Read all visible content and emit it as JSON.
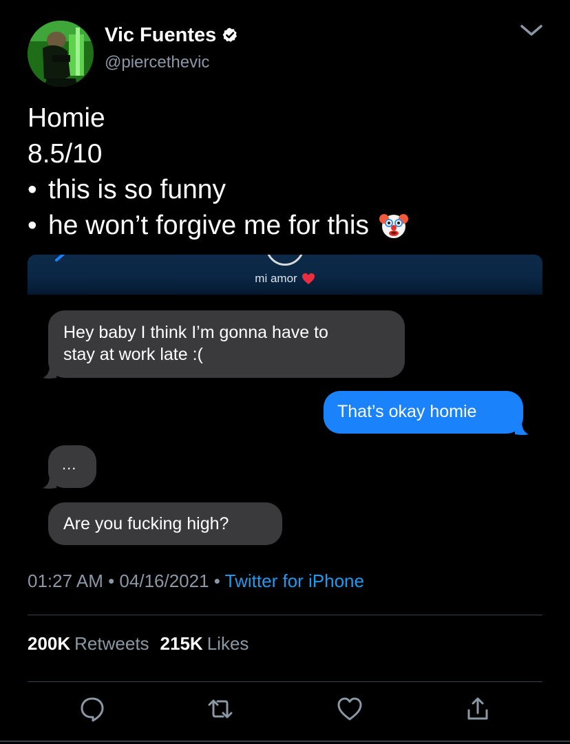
{
  "author": {
    "display_name": "Vic Fuentes",
    "handle": "@piercethevic",
    "verified": true,
    "avatar_icon": "profile-photo"
  },
  "tweet": {
    "lines": [
      "Homie",
      "8.5/10",
      "• this is so funny",
      "• he won’t forgive me for this"
    ],
    "line3_text": "this is so funny",
    "line4_text": "he won’t forgive me for this",
    "bullet": "•",
    "trailing_emoji": "clown-face-emoji"
  },
  "media": {
    "contact_name": "mi amor",
    "contact_emoji": "red-heart-emoji",
    "messages": [
      {
        "direction": "incoming",
        "text_line1": "Hey baby I think I’m gonna have to",
        "text_line2": "stay at work late :("
      },
      {
        "direction": "outgoing",
        "text": "That’s okay homie"
      },
      {
        "direction": "incoming",
        "text": "..."
      },
      {
        "direction": "incoming",
        "text": "Are you fucking high?"
      }
    ]
  },
  "meta": {
    "time": "01:27 AM",
    "separator": " • ",
    "date": "04/16/2021",
    "source": "Twitter for iPhone"
  },
  "stats": {
    "retweets_count": "200K",
    "retweets_label": "Retweets",
    "likes_count": "215K",
    "likes_label": "Likes"
  },
  "actions": [
    "reply-icon",
    "retweet-icon",
    "like-icon",
    "share-icon"
  ],
  "colors": {
    "background": "#000000",
    "secondary_text": "#8b98a5",
    "link": "#1d9bf0",
    "incoming_bubble": "#3a3a3c",
    "outgoing_bubble": "#1a82fb",
    "divider": "#38444d"
  }
}
